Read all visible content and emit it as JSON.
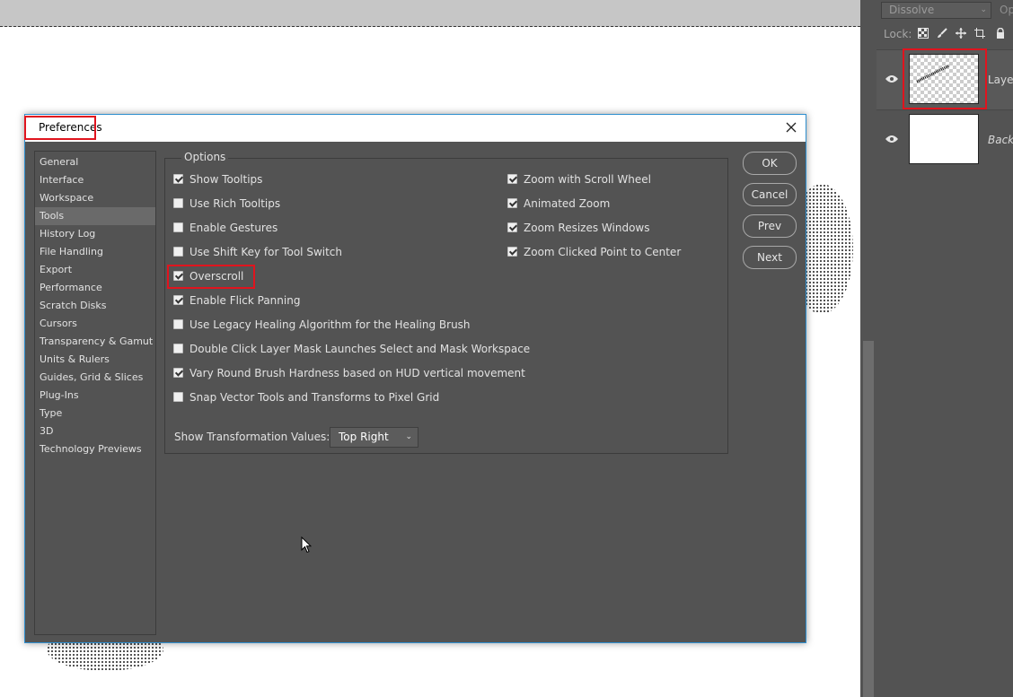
{
  "canvas": {},
  "layers_panel": {
    "blend_mode": "Dissolve",
    "opacity_label": "Op",
    "lock_label": "Lock:",
    "lock_icons": [
      "transparent-pixels-lock-icon",
      "brush-lock-icon",
      "move-lock-icon",
      "artboard-lock-icon",
      "padlock-icon"
    ],
    "layers": [
      {
        "name": "Laye",
        "visible": true,
        "selected": true
      },
      {
        "name": "Back",
        "visible": true,
        "selected": false
      }
    ]
  },
  "dialog": {
    "title": "Preferences",
    "nav_items": [
      "General",
      "Interface",
      "Workspace",
      "Tools",
      "History Log",
      "File Handling",
      "Export",
      "Performance",
      "Scratch Disks",
      "Cursors",
      "Transparency & Gamut",
      "Units & Rulers",
      "Guides, Grid & Slices",
      "Plug-Ins",
      "Type",
      "3D",
      "Technology Previews"
    ],
    "active_nav": "Tools",
    "options_legend": "Options",
    "options_left": [
      {
        "label": "Show Tooltips",
        "checked": true
      },
      {
        "label": "Use Rich Tooltips",
        "checked": false
      },
      {
        "label": "Enable Gestures",
        "checked": false
      },
      {
        "label": "Use Shift Key for Tool Switch",
        "checked": false
      },
      {
        "label": "Overscroll",
        "checked": true
      },
      {
        "label": "Enable Flick Panning",
        "checked": true
      },
      {
        "label": "Use Legacy Healing Algorithm for the Healing Brush",
        "checked": false
      },
      {
        "label": "Double Click Layer Mask Launches Select and Mask Workspace",
        "checked": false
      },
      {
        "label": "Vary Round Brush Hardness based on HUD vertical movement",
        "checked": true
      },
      {
        "label": "Snap Vector Tools and Transforms to Pixel Grid",
        "checked": false
      }
    ],
    "options_right": [
      {
        "label": "Zoom with Scroll Wheel",
        "checked": true
      },
      {
        "label": "Animated Zoom",
        "checked": true
      },
      {
        "label": "Zoom Resizes Windows",
        "checked": true
      },
      {
        "label": "Zoom Clicked Point to Center",
        "checked": true
      }
    ],
    "transform_label": "Show Transformation Values:",
    "transform_value": "Top Right",
    "buttons": {
      "ok": "OK",
      "cancel": "Cancel",
      "prev": "Prev",
      "next": "Next"
    }
  },
  "colors": {
    "panel_bg": "#535353",
    "highlight_red": "#e0141e",
    "dialog_border": "#2f8fcf"
  }
}
